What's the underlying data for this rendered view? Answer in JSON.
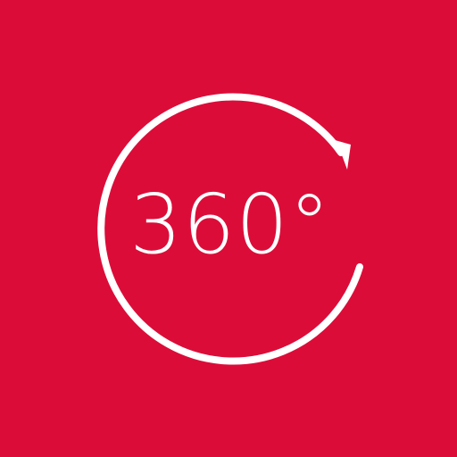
{
  "icon": {
    "label": "360°",
    "background_color": "#dc0c39",
    "foreground_color": "#ffffff",
    "glyph": "rotate-arrow-icon"
  }
}
